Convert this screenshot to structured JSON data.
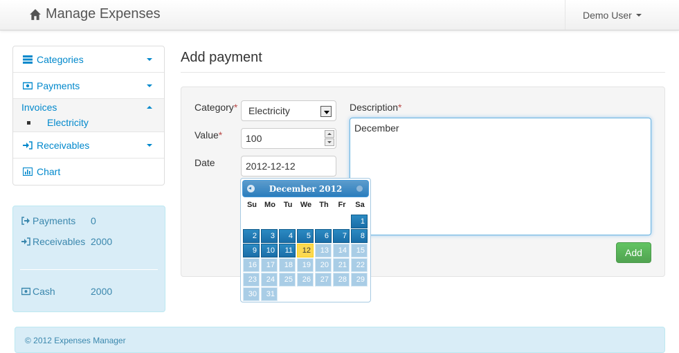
{
  "navbar": {
    "brand": "Manage Expenses",
    "user": "Demo User"
  },
  "sidebar": {
    "items": [
      {
        "label": "Categories"
      },
      {
        "label": "Payments"
      },
      {
        "label": "Invoices",
        "sub": "Electricity"
      },
      {
        "label": "Receivables"
      },
      {
        "label": "Chart"
      }
    ]
  },
  "summary": {
    "payments_label": "Payments",
    "payments_value": "0",
    "receivables_label": "Receivables",
    "receivables_value": "2000",
    "cash_label": "Cash",
    "cash_value": "2000"
  },
  "form": {
    "title": "Add payment",
    "category_label": "Category",
    "category_value": "Electricity",
    "value_label": "Value",
    "value_value": "100",
    "date_label": "Date",
    "date_value": "2012-12-12",
    "description_label": "Description",
    "description_value": "December",
    "required_mark": "*",
    "add_button": "Add"
  },
  "datepicker": {
    "month_title": "December 2012",
    "dows": [
      "Su",
      "Mo",
      "Tu",
      "We",
      "Th",
      "Fr",
      "Sa"
    ],
    "days": [
      [
        "",
        "",
        "",
        "",
        "",
        "",
        "1"
      ],
      [
        "2",
        "3",
        "4",
        "5",
        "6",
        "7",
        "8"
      ],
      [
        "9",
        "10",
        "11",
        "12",
        "13",
        "14",
        "15"
      ],
      [
        "16",
        "17",
        "18",
        "19",
        "20",
        "21",
        "22"
      ],
      [
        "23",
        "24",
        "25",
        "26",
        "27",
        "28",
        "29"
      ],
      [
        "30",
        "31",
        "",
        "",
        "",
        "",
        ""
      ]
    ],
    "selected": "12",
    "enabled_through": 11
  },
  "footer": {
    "text": "© 2012 Expenses Manager"
  },
  "colors": {
    "link": "#0088cc",
    "info_bg": "#d9edf7",
    "success": "#51a351"
  }
}
